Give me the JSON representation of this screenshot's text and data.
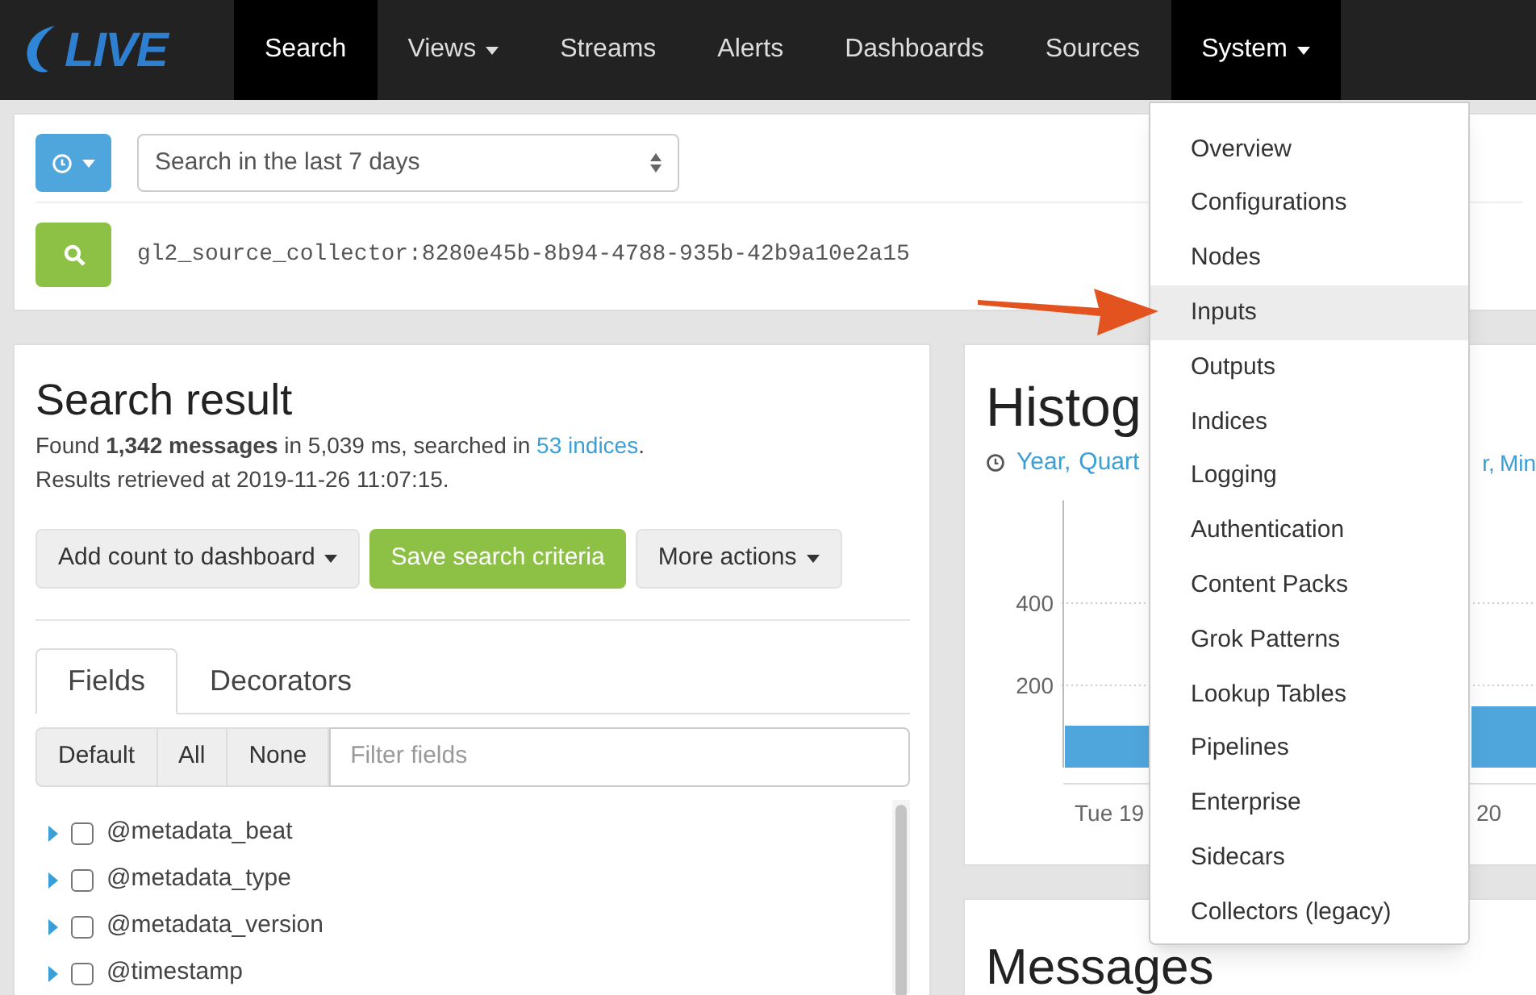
{
  "navbar": {
    "logo": "LIVE",
    "items": [
      {
        "label": "Search",
        "selected": true,
        "dropdown": false
      },
      {
        "label": "Views",
        "selected": false,
        "dropdown": true
      },
      {
        "label": "Streams",
        "selected": false,
        "dropdown": false
      },
      {
        "label": "Alerts",
        "selected": false,
        "dropdown": false
      },
      {
        "label": "Dashboards",
        "selected": false,
        "dropdown": false
      },
      {
        "label": "Sources",
        "selected": false,
        "dropdown": false
      },
      {
        "label": "System",
        "selected": true,
        "dropdown": true
      }
    ]
  },
  "search_bar": {
    "range": "Search in the last 7 days",
    "query": "gl2_source_collector:8280e45b-8b94-4788-935b-42b9a10e2a15"
  },
  "search_result": {
    "title": "Search result",
    "summary": "Found **1,342 messages** in 5,039 ms, searched in ",
    "indices_link": "53 indices",
    "summary_end": ".",
    "retrieved": "Results retrieved at 2019-11-26 11:07:15.",
    "buttons": [
      {
        "label": "Add count to dashboard",
        "kind": "dropdown"
      },
      {
        "label": "Save search criteria",
        "kind": "primary"
      },
      {
        "label": "More actions",
        "kind": "dropdown"
      }
    ],
    "tabs": [
      {
        "label": "Fields",
        "selected": true
      },
      {
        "label": "Decorators",
        "selected": false
      }
    ],
    "field_buttons": [
      "Default",
      "All",
      "None"
    ],
    "filter": {
      "placeholder": "Filter fields"
    },
    "fields": [
      {
        "name": "@metadata_beat",
        "checked": false
      },
      {
        "name": "@metadata_type",
        "checked": false
      },
      {
        "name": "@metadata_version",
        "checked": false
      },
      {
        "name": "@timestamp",
        "checked": false
      }
    ]
  },
  "histogram": {
    "title": "Histog",
    "links_left": [
      "Year,",
      "Quart"
    ],
    "links_right": [
      "r,",
      "Min"
    ],
    "chart_data": {
      "type": "bar",
      "categories": [
        "Tue 19",
        "20"
      ],
      "values": [
        102,
        149
      ],
      "ylim": [
        0,
        650
      ],
      "yticks": [
        200,
        400
      ]
    }
  },
  "messages": {
    "title": "Messages"
  },
  "system_menu": {
    "items": [
      {
        "label": "Overview",
        "selected": false
      },
      {
        "label": "Configurations",
        "selected": false
      },
      {
        "label": "Nodes",
        "selected": false
      },
      {
        "label": "Inputs",
        "selected": true
      },
      {
        "label": "Outputs",
        "selected": false
      },
      {
        "label": "Indices",
        "selected": false
      },
      {
        "label": "Logging",
        "selected": false
      },
      {
        "label": "Authentication",
        "selected": false
      },
      {
        "label": "Content Packs",
        "selected": false
      },
      {
        "label": "Grok Patterns",
        "selected": false
      },
      {
        "label": "Lookup Tables",
        "selected": false
      },
      {
        "label": "Pipelines",
        "selected": false
      },
      {
        "label": "Enterprise",
        "selected": false
      },
      {
        "label": "Sidecars",
        "selected": false
      },
      {
        "label": "Collectors (legacy)",
        "selected": false
      }
    ]
  }
}
